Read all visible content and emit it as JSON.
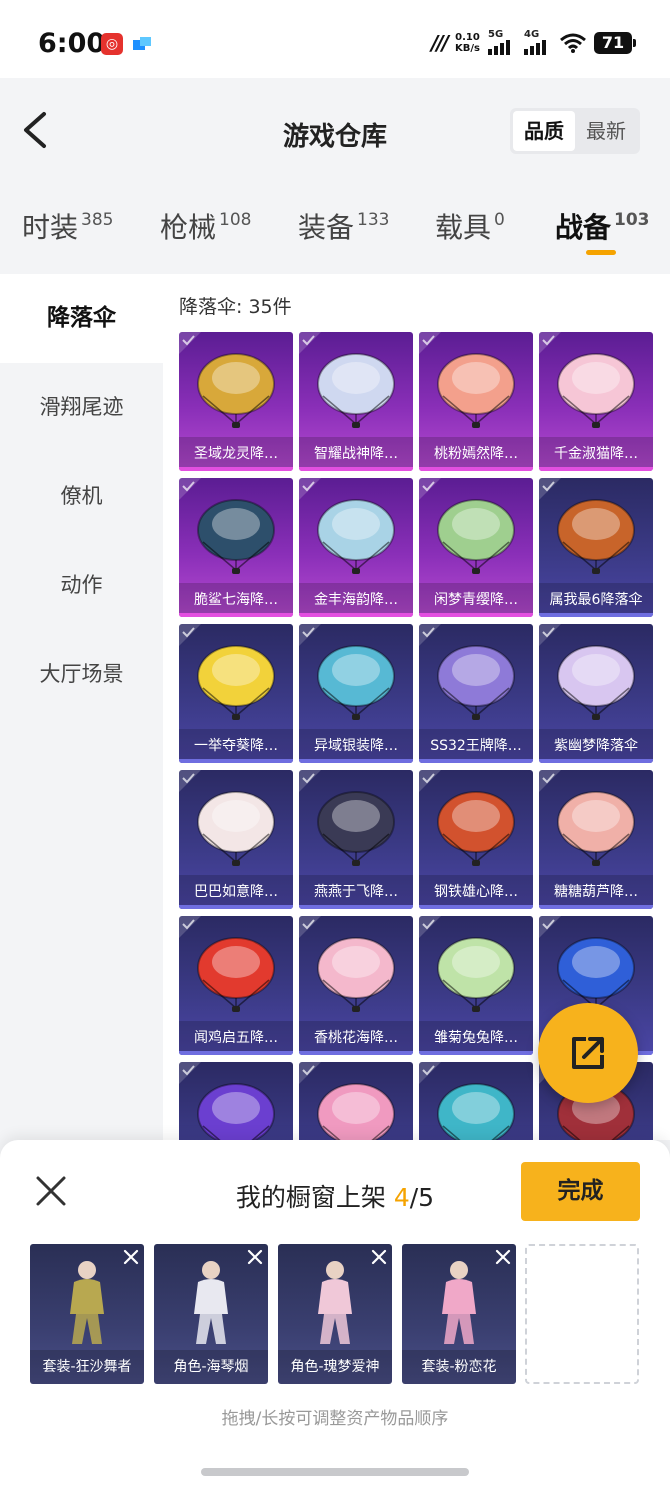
{
  "status_bar": {
    "time": "6:00",
    "speed": "0.10",
    "speed_unit": "KB/s",
    "net1": "5G",
    "net2": "4G",
    "battery": "71"
  },
  "header": {
    "title": "游戏仓库",
    "sort_options": [
      "品质",
      "最新"
    ],
    "active_sort": "品质"
  },
  "tabs": [
    {
      "label": "时装",
      "count": "385"
    },
    {
      "label": "枪械",
      "count": "108"
    },
    {
      "label": "装备",
      "count": "133"
    },
    {
      "label": "载具",
      "count": "0"
    },
    {
      "label": "战备",
      "count": "103"
    }
  ],
  "active_tab": "战备",
  "sidebar": {
    "items": [
      "降落伞",
      "滑翔尾迹",
      "僚机",
      "动作",
      "大厅场景"
    ],
    "active": "降落伞"
  },
  "content": {
    "count_label": "降落伞: 35件",
    "items": [
      {
        "name": "圣域龙灵降…",
        "rarity": "purple",
        "color": "#d8a83a"
      },
      {
        "name": "智耀战神降…",
        "rarity": "purple",
        "color": "#cfd8f0"
      },
      {
        "name": "桃粉嫣然降…",
        "rarity": "purple",
        "color": "#f3a08c"
      },
      {
        "name": "千金淑猫降…",
        "rarity": "purple",
        "color": "#f6c6d6"
      },
      {
        "name": "脆鲨七海降…",
        "rarity": "purple",
        "color": "#2d4f6b"
      },
      {
        "name": "金丰海韵降…",
        "rarity": "purple",
        "color": "#a9d3e6"
      },
      {
        "name": "闲梦青缨降…",
        "rarity": "purple",
        "color": "#9fcf8f"
      },
      {
        "name": "属我最6降落伞",
        "rarity": "blue",
        "color": "#c8642a"
      },
      {
        "name": "一举夺葵降…",
        "rarity": "blue",
        "color": "#f2d23a"
      },
      {
        "name": "异域银装降…",
        "rarity": "blue",
        "color": "#57b9d4"
      },
      {
        "name": "SS32王牌降…",
        "rarity": "blue",
        "color": "#8e7ad8"
      },
      {
        "name": "紫幽梦降落伞",
        "rarity": "blue",
        "color": "#d8c6f0"
      },
      {
        "name": "巴巴如意降…",
        "rarity": "blue",
        "color": "#f3e6e6"
      },
      {
        "name": "燕燕于飞降…",
        "rarity": "blue",
        "color": "#3a3a55"
      },
      {
        "name": "钢铁雄心降…",
        "rarity": "blue",
        "color": "#d2522e"
      },
      {
        "name": "糖糖葫芦降…",
        "rarity": "blue",
        "color": "#f0b0a8"
      },
      {
        "name": "闻鸡启五降…",
        "rarity": "blue",
        "color": "#e23a2e"
      },
      {
        "name": "香桃花海降…",
        "rarity": "blue",
        "color": "#f4b8cc"
      },
      {
        "name": "雏菊兔兔降…",
        "rarity": "blue",
        "color": "#bfe3a8"
      },
      {
        "name": "",
        "rarity": "blue",
        "color": "#2f5fd8"
      },
      {
        "name": "",
        "rarity": "blue",
        "color": "#6b3fd0"
      },
      {
        "name": "",
        "rarity": "blue",
        "color": "#f09ac0"
      },
      {
        "name": "",
        "rarity": "blue",
        "color": "#3fb6c8"
      },
      {
        "name": "",
        "rarity": "blue",
        "color": "#a0303a"
      }
    ]
  },
  "panel": {
    "title_prefix": "我的橱窗上架 ",
    "title_count": "4",
    "title_suffix": "/5",
    "done_label": "完成",
    "shelf": [
      {
        "name": "套装-狂沙舞者",
        "color": "#b8a850"
      },
      {
        "name": "角色-海琴烟",
        "color": "#e8e8f0"
      },
      {
        "name": "角色-瑰梦爱神",
        "color": "#f0c8d8"
      },
      {
        "name": "套装-粉恋花",
        "color": "#f0a8c8"
      }
    ],
    "hint": "拖拽/长按可调整资产物品顺序"
  }
}
